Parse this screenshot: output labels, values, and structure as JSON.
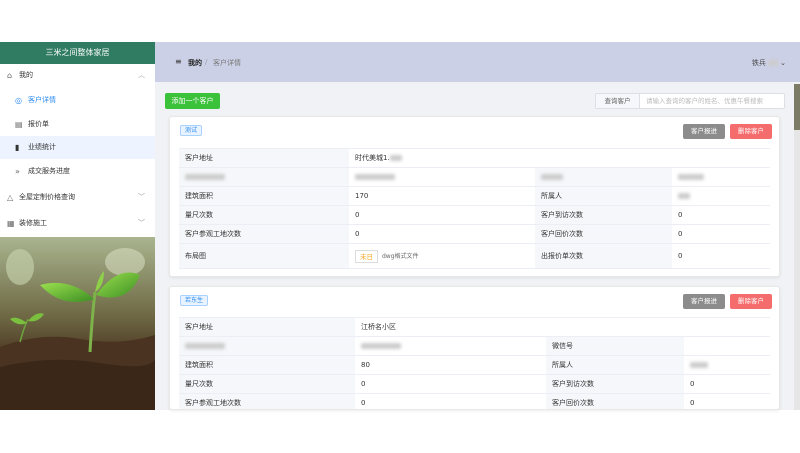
{
  "sidebar": {
    "title": "三米之间整体家居",
    "menu": [
      {
        "icon": "home-icon",
        "label": "我的",
        "expanded": true
      },
      {
        "icon": "target-icon",
        "label": "客户详情",
        "sub": true,
        "active": true
      },
      {
        "icon": "document-icon",
        "label": "报价单",
        "sub": true
      },
      {
        "icon": "bar-chart-icon",
        "label": "业绩统计",
        "sub": true
      },
      {
        "icon": "double-arrow-icon",
        "label": "成交服务进度",
        "sub": true
      },
      {
        "icon": "house-icon",
        "label": "全屋定制价格查询",
        "expanded": false
      },
      {
        "icon": "building-icon",
        "label": "装修施工",
        "expanded": false
      }
    ]
  },
  "header": {
    "breadcrumb": [
      "我的",
      "客户详情"
    ],
    "user": "铁兵"
  },
  "toolbar": {
    "add_label": "添加一个客户",
    "search_prefix": "查询客户",
    "search_placeholder": "请输入查询的客户的姓名、优惠午餐搜索"
  },
  "cards": [
    {
      "tag": "测试",
      "btn_progress": "客户报进",
      "btn_delete": "删除客户",
      "rows": [
        {
          "k1": "客户地址",
          "v1": "时代美城1.",
          "full": true
        },
        {
          "k1": "",
          "v1": "",
          "k2": "微信号",
          "v2": ""
        },
        {
          "k1": "建筑面积",
          "v1": "170",
          "k2": "所属人",
          "v2": ""
        },
        {
          "k1": "量尺次数",
          "v1": "0",
          "k2": "客户到访次数",
          "v2": "0"
        },
        {
          "k1": "客户参观工地次数",
          "v1": "0",
          "k2": "客户回价次数",
          "v2": "0"
        },
        {
          "k1": "布局图",
          "v1": "未日",
          "file_note": "dwg格式文件",
          "k2": "出报价单次数",
          "v2": "0"
        }
      ]
    },
    {
      "tag": "若东生",
      "btn_progress": "客户报进",
      "btn_delete": "删除客户",
      "rows": [
        {
          "k1": "客户地址",
          "v1": "江桥名小区",
          "full": true
        },
        {
          "k1": "",
          "v1": "",
          "k2": "微信号",
          "v2": ""
        },
        {
          "k1": "建筑面积",
          "v1": "80",
          "k2": "所属人",
          "v2": ""
        },
        {
          "k1": "量尺次数",
          "v1": "0",
          "k2": "客户到访次数",
          "v2": "0"
        },
        {
          "k1": "客户参观工地次数",
          "v1": "0",
          "k2": "客户回价次数",
          "v2": "0"
        }
      ]
    }
  ],
  "colors": {
    "brand": "#2f7c62",
    "header": "#ccd0e6",
    "add": "#3cc13b",
    "danger": "#f56c6c",
    "accent": "#2d8cf0"
  }
}
